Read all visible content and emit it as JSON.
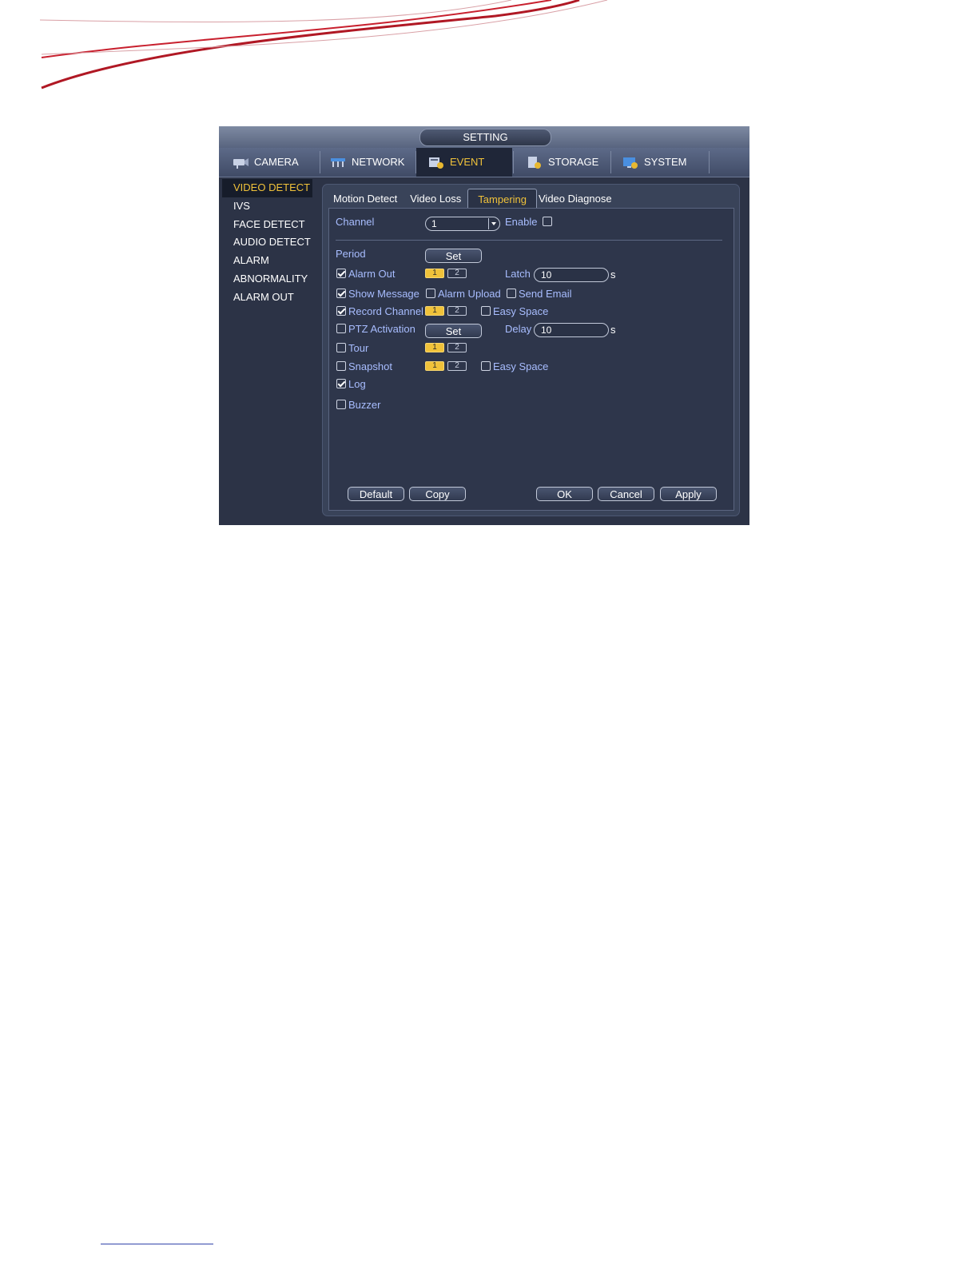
{
  "window": {
    "title": "SETTING"
  },
  "menu": [
    {
      "label": "CAMERA",
      "icon": "camera-icon"
    },
    {
      "label": "NETWORK",
      "icon": "network-icon"
    },
    {
      "label": "EVENT",
      "icon": "event-icon",
      "active": true
    },
    {
      "label": "STORAGE",
      "icon": "storage-icon"
    },
    {
      "label": "SYSTEM",
      "icon": "system-icon"
    }
  ],
  "sidebar": [
    {
      "label": "VIDEO DETECT",
      "active": true
    },
    {
      "label": "IVS"
    },
    {
      "label": "FACE DETECT"
    },
    {
      "label": "AUDIO DETECT"
    },
    {
      "label": "ALARM"
    },
    {
      "label": "ABNORMALITY"
    },
    {
      "label": "ALARM OUT"
    }
  ],
  "subtabs": [
    {
      "label": "Motion Detect"
    },
    {
      "label": "Video Loss"
    },
    {
      "label": "Tampering",
      "active": true
    },
    {
      "label": "Video Diagnose"
    }
  ],
  "form": {
    "channel_label": "Channel",
    "channel_value": "1",
    "enable_label": "Enable",
    "enable_checked": false,
    "period_label": "Period",
    "set_label": "Set",
    "alarm_out_label": "Alarm Out",
    "alarm_out_checked": true,
    "latch_label": "Latch",
    "latch_value": "10",
    "seconds_unit": "s",
    "show_message_label": "Show Message",
    "show_message_checked": true,
    "alarm_upload_label": "Alarm Upload",
    "alarm_upload_checked": false,
    "send_email_label": "Send Email",
    "send_email_checked": false,
    "record_channel_label": "Record Channel",
    "record_channel_checked": true,
    "easy_space_label": "Easy Space",
    "ptz_label": "PTZ Activation",
    "ptz_checked": false,
    "delay_label": "Delay",
    "delay_value": "10",
    "tour_label": "Tour",
    "tour_checked": false,
    "snapshot_label": "Snapshot",
    "snapshot_checked": false,
    "log_label": "Log",
    "log_checked": true,
    "buzzer_label": "Buzzer",
    "buzzer_checked": false,
    "channel_numbers": [
      "1",
      "2"
    ]
  },
  "buttons": {
    "default": "Default",
    "copy": "Copy",
    "ok": "OK",
    "cancel": "Cancel",
    "apply": "Apply"
  },
  "colors": {
    "accent": "#f0c23a",
    "label_blue": "#a8bdff",
    "banner_red": "#c8202e"
  }
}
